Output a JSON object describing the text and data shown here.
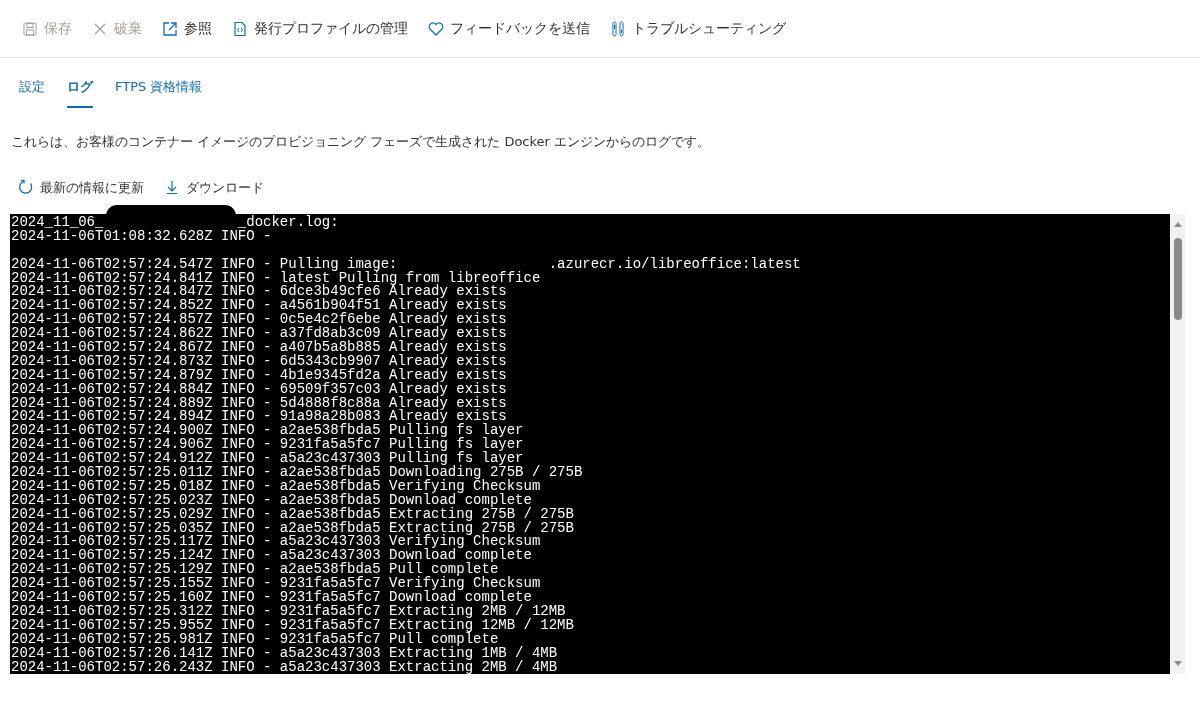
{
  "toolbar": [
    {
      "kind": "save",
      "label": "保存",
      "disabled": true
    },
    {
      "kind": "discard",
      "label": "破棄",
      "disabled": true
    },
    {
      "kind": "browse",
      "label": "参照",
      "disabled": false
    },
    {
      "kind": "profile",
      "label": "発行プロファイルの管理",
      "disabled": false
    },
    {
      "kind": "feedback",
      "label": "フィードバックを送信",
      "disabled": false
    },
    {
      "kind": "troubleshoot",
      "label": "トラブルシューティング",
      "disabled": false
    }
  ],
  "tabs": [
    {
      "label": "設定",
      "selected": false
    },
    {
      "label": "ログ",
      "selected": true
    },
    {
      "label": "FTPS 資格情報",
      "selected": false
    }
  ],
  "description": "これらは、お客様のコンテナー イメージのプロビジョニング フェーズで生成された Docker エンジンからのログです。",
  "actions": [
    {
      "kind": "refresh",
      "label": "最新の情報に更新"
    },
    {
      "kind": "download",
      "label": "ダウンロード"
    }
  ],
  "log": [
    {
      "kind": "redacted",
      "before": "2024_11_06_",
      "after": "_docker.log:"
    },
    {
      "kind": "text",
      "text": "2024-11-06T01:08:32.628Z INFO -"
    },
    {
      "kind": "blank"
    },
    {
      "kind": "gap",
      "before": "2024-11-06T02:57:24.547Z INFO - Pulling image:",
      "after": ".azurecr.io/libreoffice:latest"
    },
    {
      "kind": "text",
      "text": "2024-11-06T02:57:24.841Z INFO - latest Pulling from libreoffice"
    },
    {
      "kind": "text",
      "text": "2024-11-06T02:57:24.847Z INFO - 6dce3b49cfe6 Already exists"
    },
    {
      "kind": "text",
      "text": "2024-11-06T02:57:24.852Z INFO - a4561b904f51 Already exists"
    },
    {
      "kind": "text",
      "text": "2024-11-06T02:57:24.857Z INFO - 0c5e4c2f6ebe Already exists"
    },
    {
      "kind": "text",
      "text": "2024-11-06T02:57:24.862Z INFO - a37fd8ab3c09 Already exists"
    },
    {
      "kind": "text",
      "text": "2024-11-06T02:57:24.867Z INFO - a407b5a8b885 Already exists"
    },
    {
      "kind": "text",
      "text": "2024-11-06T02:57:24.873Z INFO - 6d5343cb9907 Already exists"
    },
    {
      "kind": "text",
      "text": "2024-11-06T02:57:24.879Z INFO - 4b1e9345fd2a Already exists"
    },
    {
      "kind": "text",
      "text": "2024-11-06T02:57:24.884Z INFO - 69509f357c03 Already exists"
    },
    {
      "kind": "text",
      "text": "2024-11-06T02:57:24.889Z INFO - 5d4888f8c88a Already exists"
    },
    {
      "kind": "text",
      "text": "2024-11-06T02:57:24.894Z INFO - 91a98a28b083 Already exists"
    },
    {
      "kind": "text",
      "text": "2024-11-06T02:57:24.900Z INFO - a2ae538fbda5 Pulling fs layer"
    },
    {
      "kind": "text",
      "text": "2024-11-06T02:57:24.906Z INFO - 9231fa5a5fc7 Pulling fs layer"
    },
    {
      "kind": "text",
      "text": "2024-11-06T02:57:24.912Z INFO - a5a23c437303 Pulling fs layer"
    },
    {
      "kind": "text",
      "text": "2024-11-06T02:57:25.011Z INFO - a2ae538fbda5 Downloading 275B / 275B"
    },
    {
      "kind": "text",
      "text": "2024-11-06T02:57:25.018Z INFO - a2ae538fbda5 Verifying Checksum"
    },
    {
      "kind": "text",
      "text": "2024-11-06T02:57:25.023Z INFO - a2ae538fbda5 Download complete"
    },
    {
      "kind": "text",
      "text": "2024-11-06T02:57:25.029Z INFO - a2ae538fbda5 Extracting 275B / 275B"
    },
    {
      "kind": "text",
      "text": "2024-11-06T02:57:25.035Z INFO - a2ae538fbda5 Extracting 275B / 275B"
    },
    {
      "kind": "text",
      "text": "2024-11-06T02:57:25.117Z INFO - a5a23c437303 Verifying Checksum"
    },
    {
      "kind": "text",
      "text": "2024-11-06T02:57:25.124Z INFO - a5a23c437303 Download complete"
    },
    {
      "kind": "text",
      "text": "2024-11-06T02:57:25.129Z INFO - a2ae538fbda5 Pull complete"
    },
    {
      "kind": "text",
      "text": "2024-11-06T02:57:25.155Z INFO - 9231fa5a5fc7 Verifying Checksum"
    },
    {
      "kind": "text",
      "text": "2024-11-06T02:57:25.160Z INFO - 9231fa5a5fc7 Download complete"
    },
    {
      "kind": "text",
      "text": "2024-11-06T02:57:25.312Z INFO - 9231fa5a5fc7 Extracting 2MB / 12MB"
    },
    {
      "kind": "text",
      "text": "2024-11-06T02:57:25.955Z INFO - 9231fa5a5fc7 Extracting 12MB / 12MB"
    },
    {
      "kind": "text",
      "text": "2024-11-06T02:57:25.981Z INFO - 9231fa5a5fc7 Pull complete"
    },
    {
      "kind": "text",
      "text": "2024-11-06T02:57:26.141Z INFO - a5a23c437303 Extracting 1MB / 4MB"
    },
    {
      "kind": "text",
      "text": "2024-11-06T02:57:26.243Z INFO - a5a23c437303 Extracting 2MB / 4MB"
    }
  ]
}
